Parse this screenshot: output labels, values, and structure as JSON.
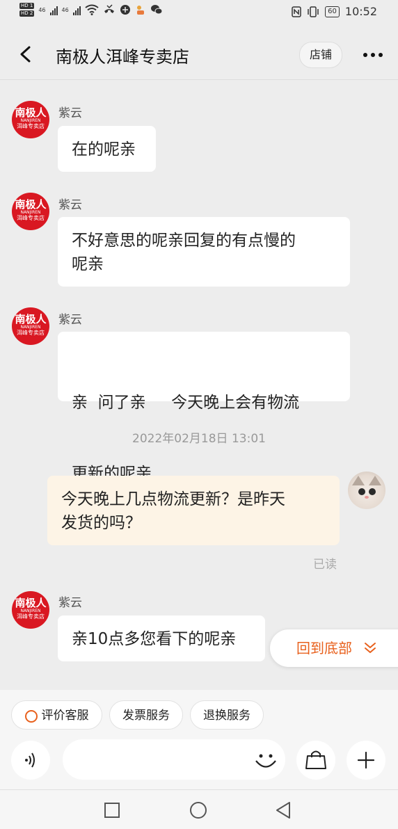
{
  "status_bar": {
    "sim1": "HD 1",
    "sim2": "HD 2",
    "net1": "46",
    "net2": "46",
    "battery": "60",
    "time": "10:52"
  },
  "header": {
    "title": "南极人洱峰专卖店",
    "shop_button": "店铺"
  },
  "shop_avatar": {
    "line1": "南极人",
    "line2": "NANJIREN",
    "line3": "洱峰专卖店"
  },
  "messages": [
    {
      "sender": "紫云",
      "text": "在的呢亲"
    },
    {
      "sender": "紫云",
      "text_line1": "不好意思的呢亲回复的有点慢的",
      "text_line2": "呢亲"
    },
    {
      "sender": "紫云",
      "text_line1": "亲  问了亲     今天晚上会有物流",
      "text_line2": "更新的呢亲"
    },
    {
      "timestamp": "2022年02月18日 13:01"
    },
    {
      "text_line1": "今天晚上几点物流更新？是昨天",
      "text_line2": "发货的吗？",
      "status": "已读"
    },
    {
      "sender": "紫云",
      "text": "亲10点多您看下的呢亲"
    }
  ],
  "back_to_bottom": "回到底部",
  "quick_actions": [
    "评价客服",
    "发票服务",
    "退换服务"
  ],
  "icons": {
    "voice": "voice-icon",
    "emoji": "emoji-icon",
    "bag": "shopping-bag-icon",
    "plus": "plus-icon"
  },
  "colors": {
    "accent": "#e8601c",
    "brand_red": "#d91822",
    "my_bubble": "#fdf4e6"
  }
}
